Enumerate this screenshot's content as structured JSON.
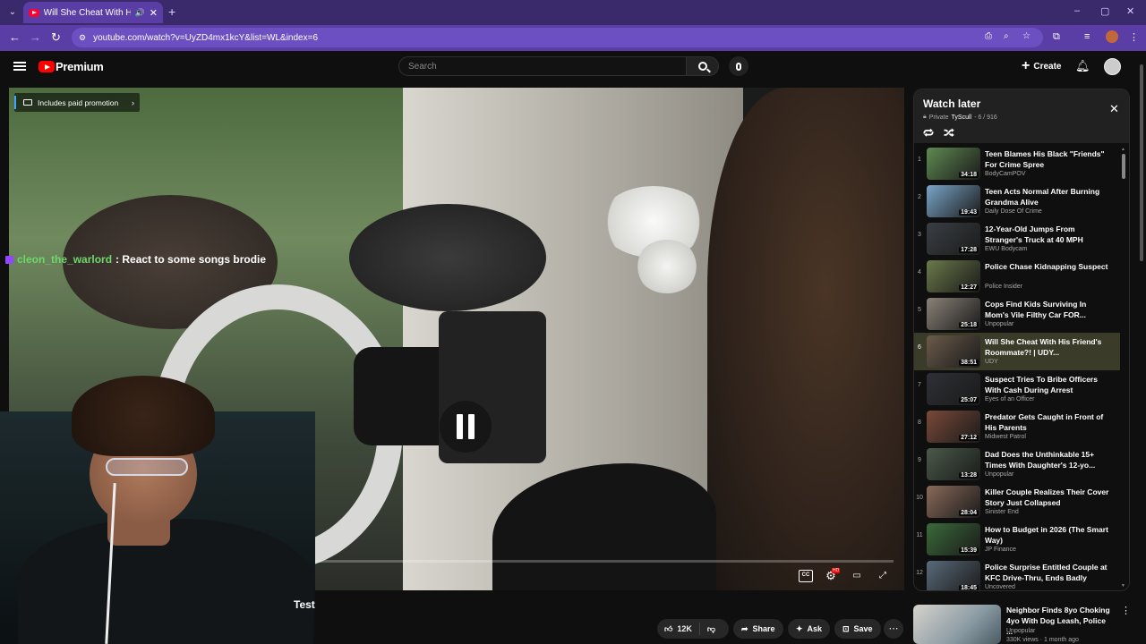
{
  "browser": {
    "tab_title": "Will She Cheat With His Fri",
    "url": "youtube.com/watch?v=UyZD4mx1kcY&list=WL&index=6"
  },
  "header": {
    "logo_text": "Premium",
    "search_placeholder": "Search",
    "create_label": "Create"
  },
  "video": {
    "promo_label": "Includes paid promotion",
    "chat_user": "cleon_the_warlord",
    "chat_message": ": React to some songs brodie",
    "title_fragment": "Test",
    "state": "paused"
  },
  "actions": {
    "likes": "12K",
    "share": "Share",
    "ask": "Ask",
    "save": "Save"
  },
  "playlist": {
    "title": "Watch later",
    "privacy": "Private",
    "owner": "TyScull",
    "position": "- 6 / 916",
    "items": [
      {
        "index": "1",
        "title": "Teen Blames His Black \"Friends\" For Crime Spree",
        "channel": "BodyCamPOV",
        "duration": "34:18",
        "color": "#5f8a52"
      },
      {
        "index": "2",
        "title": "Teen Acts Normal After Burning Grandma Alive",
        "channel": "Daily Dose Of Crime",
        "duration": "19:43",
        "color": "#7aa5c8"
      },
      {
        "index": "3",
        "title": "12-Year-Old Jumps From Stranger's Truck at 40 MPH",
        "channel": "EWU Bodycam",
        "duration": "17:28",
        "color": "#3a3f44"
      },
      {
        "index": "4",
        "title": "Police Chase Kidnapping Suspect",
        "channel": "Police Insider",
        "duration": "12:27",
        "color": "#6a7a4a"
      },
      {
        "index": "5",
        "title": "Cops Find Kids Surviving In Mom's Vile Filthy Car FOR...",
        "channel": "Unpopular",
        "duration": "25:18",
        "color": "#8a8278"
      },
      {
        "index": "6",
        "title": "Will She Cheat With His Friend's Roommate?! | UDY...",
        "channel": "UDY",
        "duration": "38:51",
        "color": "#6b5b4a"
      },
      {
        "index": "7",
        "title": "Suspect Tries To Bribe Officers With Cash During Arrest",
        "channel": "Eyes of an Officer",
        "duration": "25:07",
        "color": "#2e3036"
      },
      {
        "index": "8",
        "title": "Predator Gets Caught in Front of His Parents",
        "channel": "Midwest Patrol",
        "duration": "27:12",
        "color": "#7a4a3a"
      },
      {
        "index": "9",
        "title": "Dad Does the Unthinkable 15+ Times With Daughter's 12-yo...",
        "channel": "Unpopular",
        "duration": "13:28",
        "color": "#4a5a4a"
      },
      {
        "index": "10",
        "title": "Killer Couple Realizes Their Cover Story Just Collapsed",
        "channel": "Sinister End",
        "duration": "28:04",
        "color": "#8a6a5a"
      },
      {
        "index": "11",
        "title": "How to Budget in 2026 (The Smart Way)",
        "channel": "JP Finance",
        "duration": "15:39",
        "color": "#3a6a3a"
      },
      {
        "index": "12",
        "title": "Police Surprise Entitled Couple at KFC Drive-Thru, Ends Badly",
        "channel": "Uncovered",
        "duration": "18:45",
        "color": "#5a6a7a"
      }
    ]
  },
  "recommendation": {
    "title": "Neighbor Finds 8yo Choking 4yo With Dog Leash, Police ...",
    "channel": "Unpopular",
    "views": "330K views · 1 month ago"
  },
  "colors": {
    "browser_tabbar": "#3b2a6b",
    "browser_toolbar": "#5a3ea6",
    "yt_background": "#0f0f0f",
    "yt_red": "#ff0000",
    "chat_user": "#6dd86a"
  }
}
